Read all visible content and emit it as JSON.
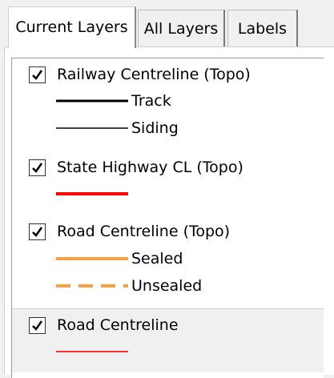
{
  "tabs": [
    {
      "label": "Current Layers",
      "active": true
    },
    {
      "label": "All Layers",
      "active": false
    },
    {
      "label": "Labels",
      "active": false
    }
  ],
  "layers": [
    {
      "name": "Railway Centreline (Topo)",
      "checked": true,
      "symbols": [
        {
          "label": "Track",
          "color": "#000000",
          "style": "solid-thick"
        },
        {
          "label": "Siding",
          "color": "#000000",
          "style": "solid-thin"
        }
      ]
    },
    {
      "name": "State Highway CL (Topo)",
      "checked": true,
      "symbols": [
        {
          "label": "",
          "color": "#ff0000",
          "style": "solid-thick"
        }
      ]
    },
    {
      "name": "Road Centreline (Topo)",
      "checked": true,
      "symbols": [
        {
          "label": "Sealed",
          "color": "#ffa040",
          "style": "solid-thick"
        },
        {
          "label": "Unsealed",
          "color": "#ffa040",
          "style": "dashed-thick"
        }
      ]
    },
    {
      "name": "Road Centreline",
      "checked": true,
      "symbols": [
        {
          "label": "",
          "color": "#ff3333",
          "style": "solid-thin"
        }
      ]
    }
  ]
}
